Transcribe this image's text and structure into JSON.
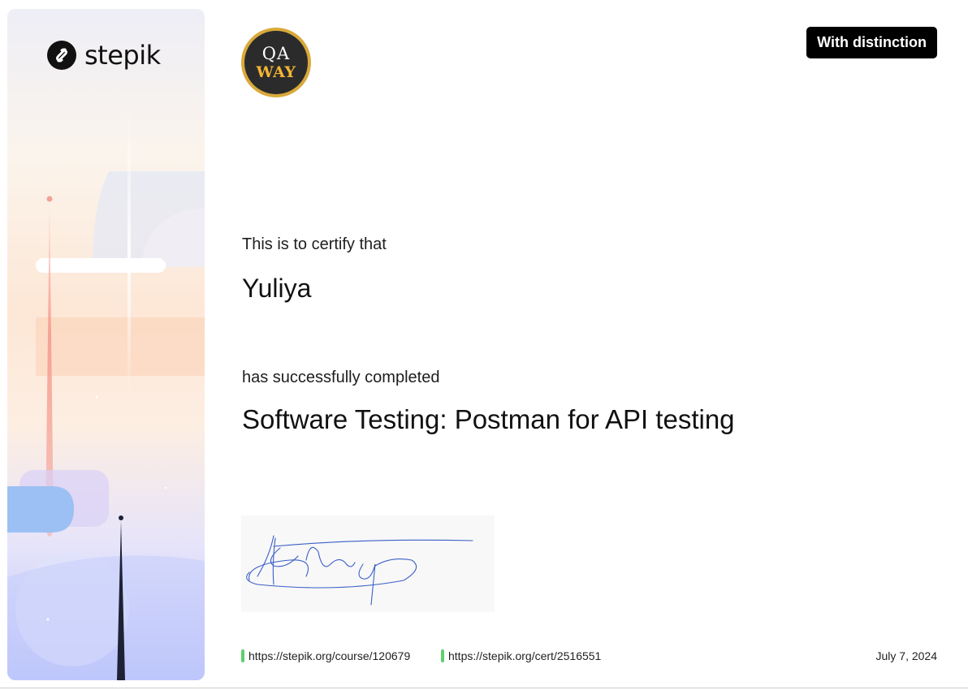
{
  "brand": {
    "name": "stepik",
    "logo_icon": "stepik-s-icon"
  },
  "badge": {
    "line1": "QA",
    "line2": "WAY",
    "icon": "qa-way-badge-icon",
    "ring_color": "#d9a93a",
    "accent_color": "#f2b534"
  },
  "distinction_label": "With distinction",
  "certificate": {
    "certify_text": "This is to certify that",
    "recipient": "Yuliya",
    "completed_text": "has successfully completed",
    "course_title": "Software Testing: Postman for API testing"
  },
  "signature": {
    "icon": "handwritten-signature",
    "ink_color": "#3a5fc8"
  },
  "footer": {
    "course_url": "https://stepik.org/course/120679",
    "cert_url": "https://stepik.org/cert/2516551",
    "date": "July 7, 2024",
    "link_marker_color": "#5fcf6e"
  }
}
